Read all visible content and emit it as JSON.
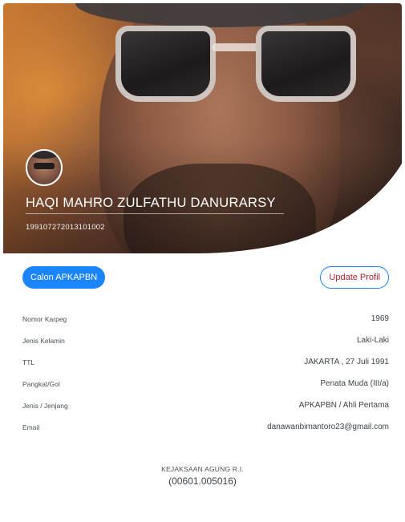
{
  "profile": {
    "name": "HAQI MAHRO ZULFATHU DANURARSY",
    "nip": "199107272013101002"
  },
  "actions": {
    "status_label": "Calon APKAPBN",
    "update_label": "Update Profil"
  },
  "details": [
    {
      "label": "Nomor Karpeg",
      "value": "1969"
    },
    {
      "label": "Jenis Kelamin",
      "value": "Laki-Laki"
    },
    {
      "label": "TTL",
      "value": "JAKARTA , 27 Juli 1991"
    },
    {
      "label": "Pangkat/Gol",
      "value": "Penata Muda (III/a)"
    },
    {
      "label": "Jenis / Jenjang",
      "value": "APKAPBN / Ahli Pertama"
    },
    {
      "label": "Email",
      "value": "danawanbimantoro23@gmail.com"
    }
  ],
  "organization": {
    "name": "KEJAKSAAN AGUNG R.I.",
    "code": "(00601.005016)"
  },
  "colors": {
    "primary": "#1a85ff",
    "update_text": "#b31f2a"
  }
}
